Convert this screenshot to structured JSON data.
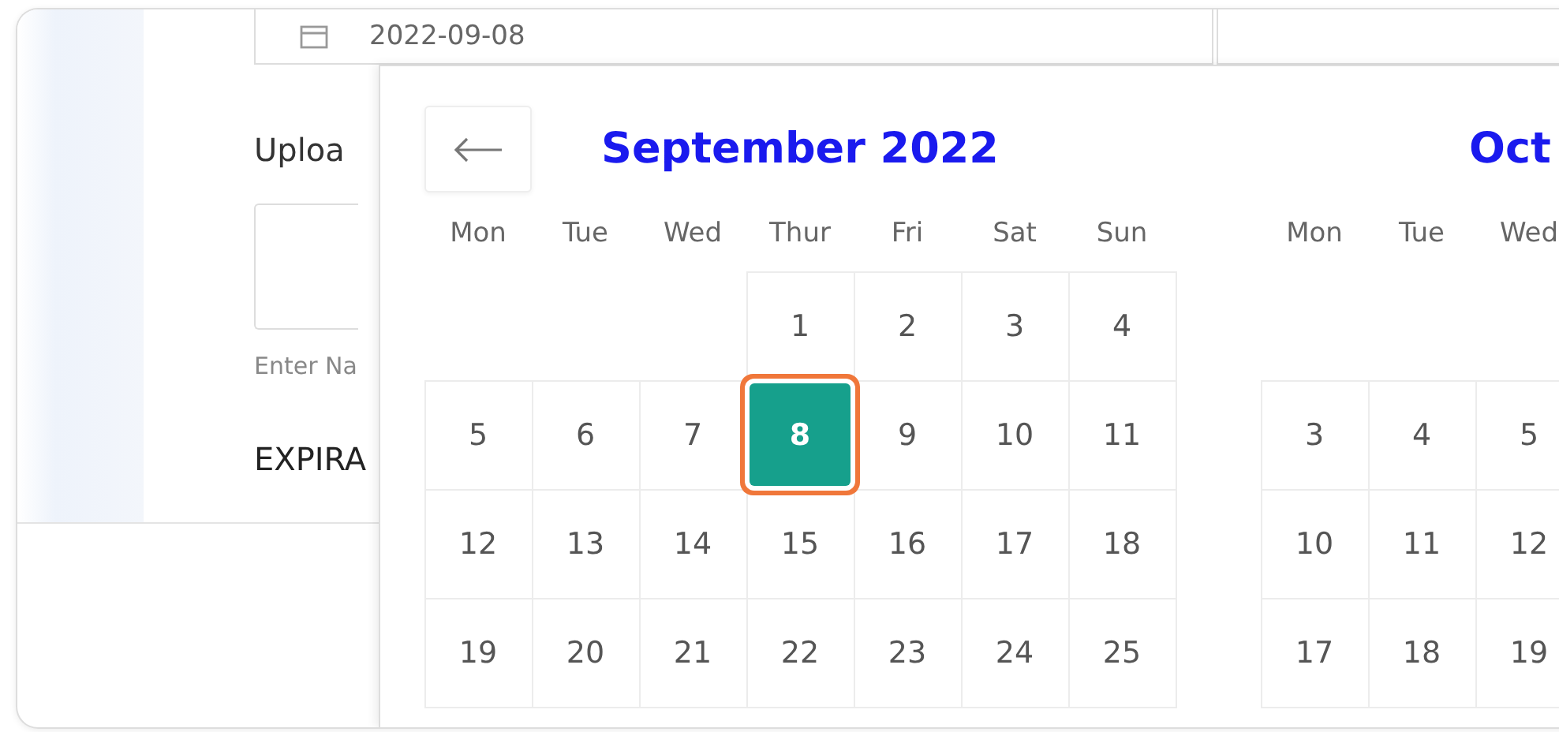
{
  "date_field": {
    "value": "2022-09-08"
  },
  "form": {
    "upload_label": "Uploa",
    "hint": "Enter Na",
    "expiration_label": "EXPIRA"
  },
  "date_picker": {
    "months": [
      {
        "title": "September 2022",
        "weekdays": [
          "Mon",
          "Tue",
          "Wed",
          "Thur",
          "Fri",
          "Sat",
          "Sun"
        ],
        "weeks": [
          [
            {
              "kind": "empty"
            },
            {
              "kind": "empty"
            },
            {
              "kind": "empty"
            },
            {
              "kind": "day",
              "label": "1",
              "selected": false
            },
            {
              "kind": "day",
              "label": "2",
              "selected": false
            },
            {
              "kind": "day",
              "label": "3",
              "selected": false
            },
            {
              "kind": "day",
              "label": "4",
              "selected": false
            }
          ],
          [
            {
              "kind": "day",
              "label": "5",
              "selected": false
            },
            {
              "kind": "day",
              "label": "6",
              "selected": false
            },
            {
              "kind": "day",
              "label": "7",
              "selected": false
            },
            {
              "kind": "day",
              "label": "8",
              "selected": true
            },
            {
              "kind": "day",
              "label": "9",
              "selected": false
            },
            {
              "kind": "day",
              "label": "10",
              "selected": false
            },
            {
              "kind": "day",
              "label": "11",
              "selected": false
            }
          ],
          [
            {
              "kind": "day",
              "label": "12",
              "selected": false
            },
            {
              "kind": "day",
              "label": "13",
              "selected": false
            },
            {
              "kind": "day",
              "label": "14",
              "selected": false
            },
            {
              "kind": "day",
              "label": "15",
              "selected": false
            },
            {
              "kind": "day",
              "label": "16",
              "selected": false
            },
            {
              "kind": "day",
              "label": "17",
              "selected": false
            },
            {
              "kind": "day",
              "label": "18",
              "selected": false
            }
          ],
          [
            {
              "kind": "day",
              "label": "19",
              "selected": false
            },
            {
              "kind": "day",
              "label": "20",
              "selected": false
            },
            {
              "kind": "day",
              "label": "21",
              "selected": false
            },
            {
              "kind": "day",
              "label": "22",
              "selected": false
            },
            {
              "kind": "day",
              "label": "23",
              "selected": false
            },
            {
              "kind": "day",
              "label": "24",
              "selected": false
            },
            {
              "kind": "day",
              "label": "25",
              "selected": false
            }
          ]
        ]
      },
      {
        "title": "Oct",
        "weekdays": [
          "Mon",
          "Tue",
          "Wed"
        ],
        "weeks": [
          [
            {
              "kind": "empty"
            },
            {
              "kind": "empty"
            },
            {
              "kind": "empty"
            }
          ],
          [
            {
              "kind": "day",
              "label": "3",
              "selected": false
            },
            {
              "kind": "day",
              "label": "4",
              "selected": false
            },
            {
              "kind": "day",
              "label": "5",
              "selected": false
            }
          ],
          [
            {
              "kind": "day",
              "label": "10",
              "selected": false
            },
            {
              "kind": "day",
              "label": "11",
              "selected": false
            },
            {
              "kind": "day",
              "label": "12",
              "selected": false
            }
          ],
          [
            {
              "kind": "day",
              "label": "17",
              "selected": false
            },
            {
              "kind": "day",
              "label": "18",
              "selected": false
            },
            {
              "kind": "day",
              "label": "19",
              "selected": false
            }
          ]
        ]
      }
    ]
  }
}
